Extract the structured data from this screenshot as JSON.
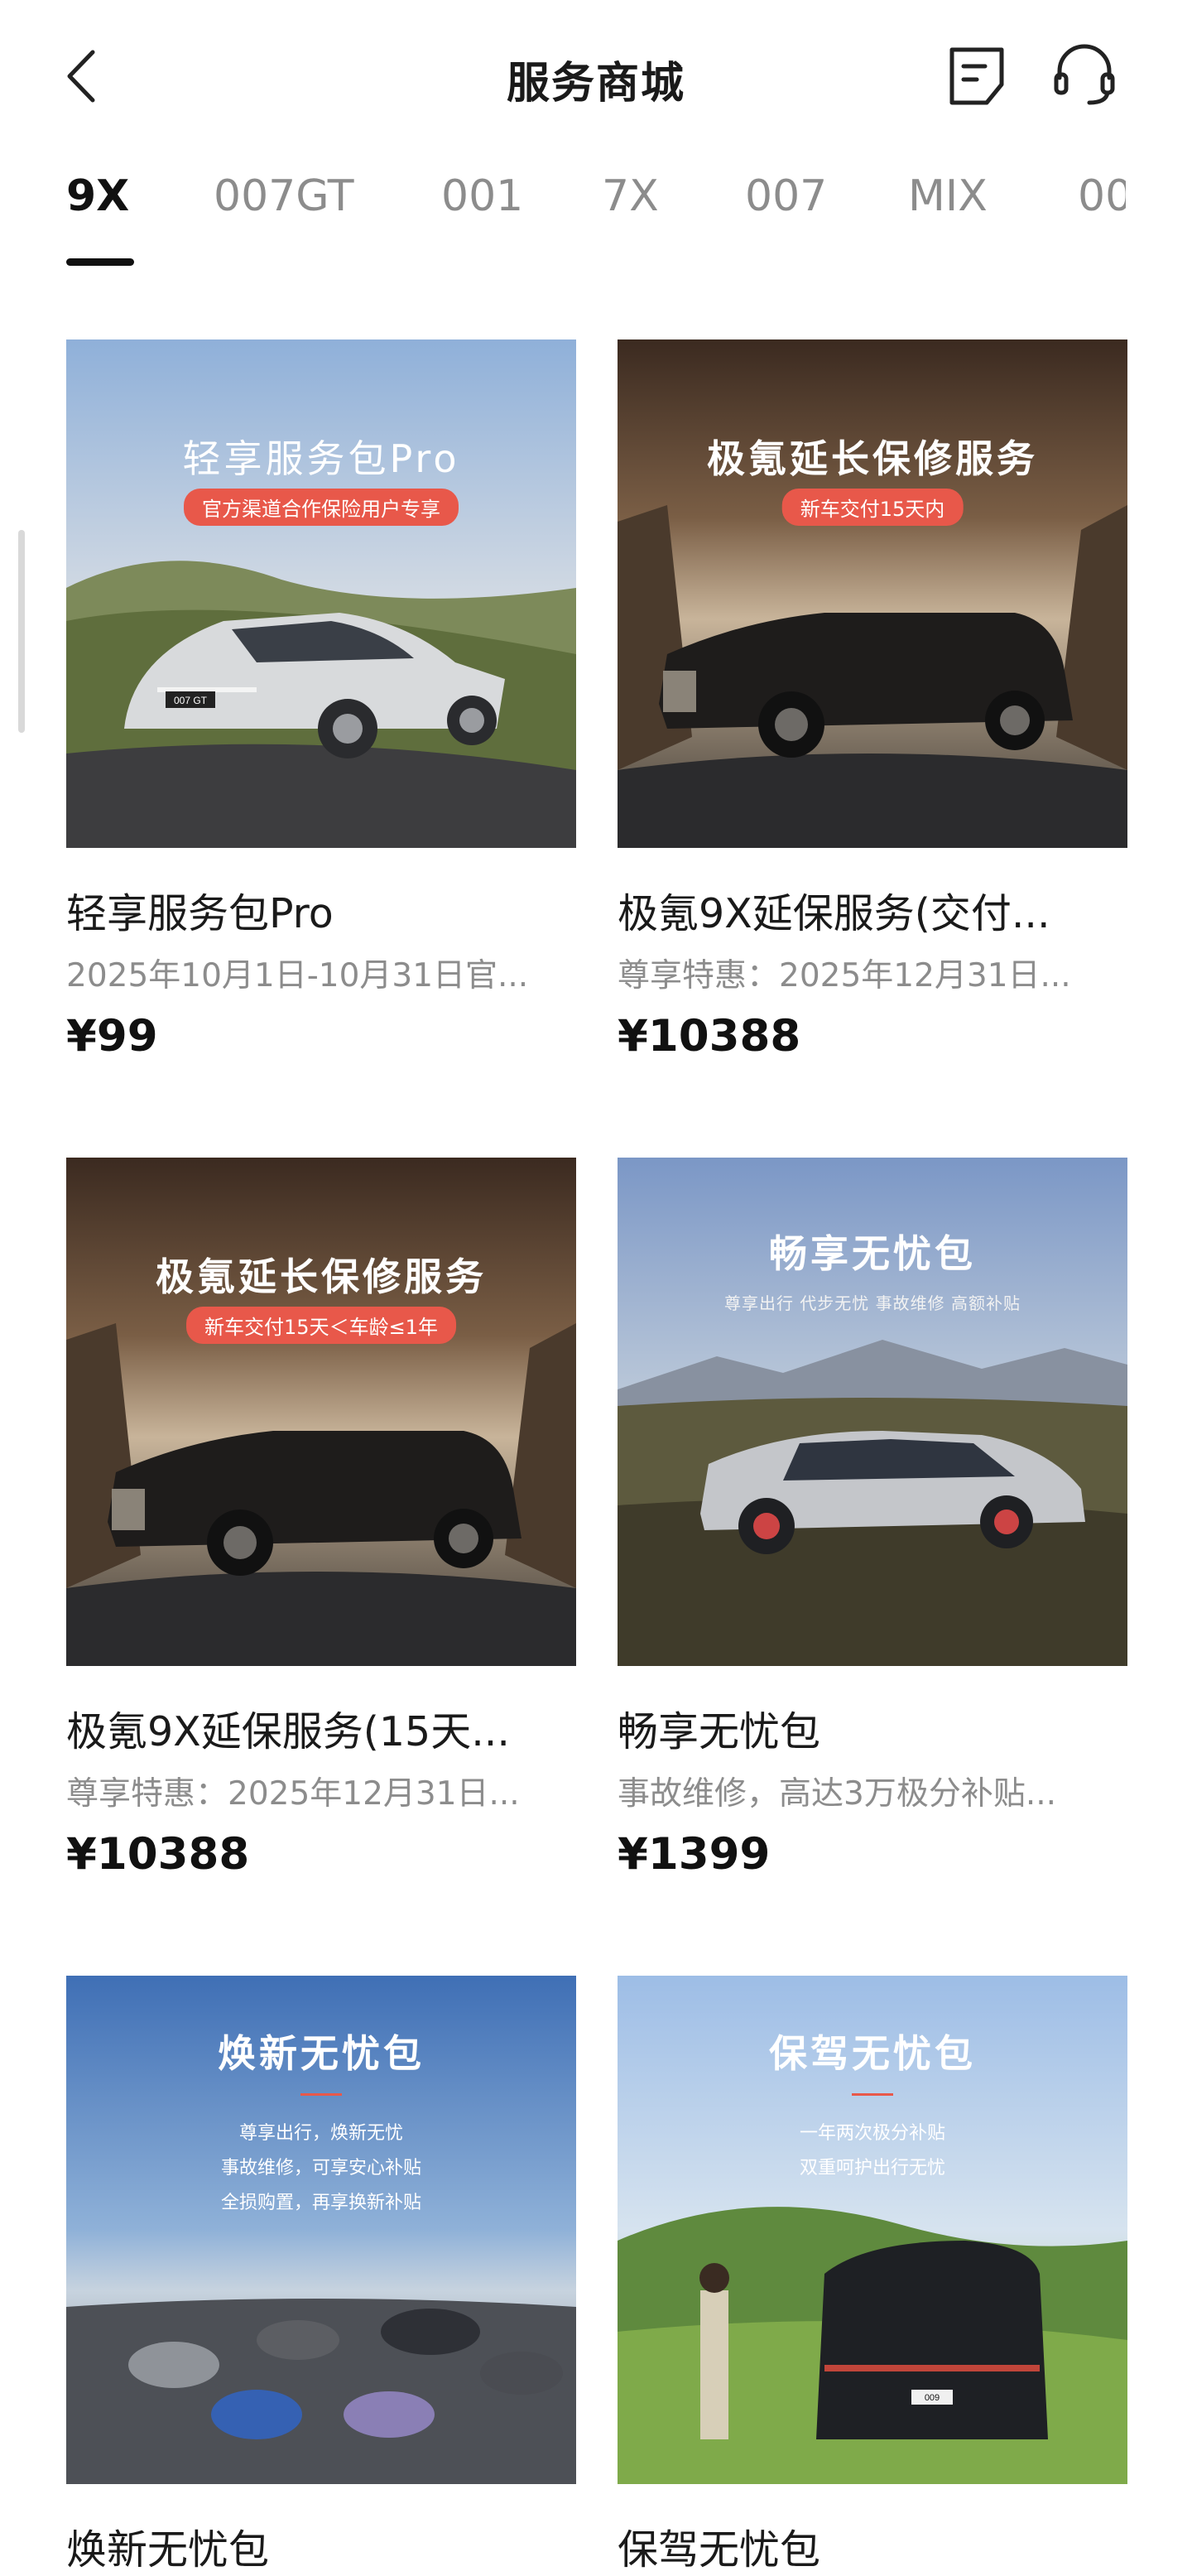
{
  "header": {
    "title": "服务商城",
    "back_icon": "chevron-left-icon",
    "order_icon": "order-list-icon",
    "service_icon": "headset-icon"
  },
  "tabs": [
    {
      "label": "9X",
      "active": true
    },
    {
      "label": "007GT"
    },
    {
      "label": "001"
    },
    {
      "label": "7X"
    },
    {
      "label": "007"
    },
    {
      "label": "MIX"
    },
    {
      "label": "00"
    }
  ],
  "products": [
    {
      "name": "轻享服务包Pro",
      "desc": "2025年10月1日-10月31日官...",
      "price": "¥99",
      "image": {
        "heading": "轻享服务包Pro",
        "badge": "官方渠道合作保险用户专享",
        "plate": "007 GT"
      }
    },
    {
      "name": "极氪9X延保服务(交付...",
      "desc": "尊享特惠：2025年12月31日...",
      "price": "¥10388",
      "image": {
        "heading": "极氪延长保修服务",
        "badge": "新车交付15天内"
      }
    },
    {
      "name": "极氪9X延保服务(15天...",
      "desc": "尊享特惠：2025年12月31日...",
      "price": "¥10388",
      "image": {
        "heading": "极氪延长保修服务",
        "badge": "新车交付15天＜车龄≤1年"
      }
    },
    {
      "name": "畅享无忧包",
      "desc": "事故维修，高达3万极分补贴...",
      "price": "¥1399",
      "image": {
        "heading": "畅享无忧包",
        "sub": "尊享出行  代步无忧  事故维修  高额补贴"
      }
    },
    {
      "name": "焕新无忧包",
      "image": {
        "heading": "焕新无忧包",
        "lines": [
          "尊享出行，焕新无忧",
          "事故维修，可享安心补贴",
          "全损购置，再享换新补贴"
        ]
      }
    },
    {
      "name": "保驾无忧包",
      "image": {
        "heading": "保驾无忧包",
        "lines": [
          "一年两次极分补贴",
          "双重呵护出行无忧"
        ],
        "plate": "009"
      }
    }
  ],
  "colors": {
    "accent": "#e8584a",
    "text": "#1a1a1a",
    "muted": "#8c8c8c"
  }
}
